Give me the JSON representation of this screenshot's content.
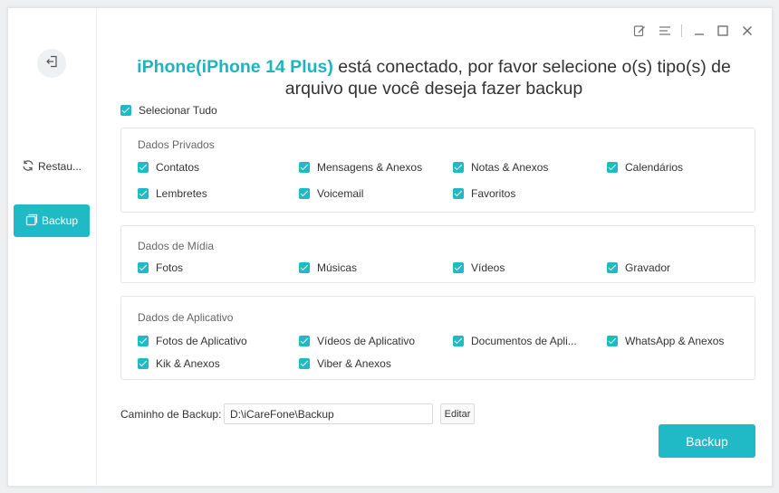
{
  "window": {
    "controls": [
      "feedback-icon",
      "menu-icon",
      "minimize-icon",
      "maximize-icon",
      "close-icon"
    ]
  },
  "sidebar": {
    "back_icon": "exit-icon",
    "items": [
      {
        "label": "Restau...",
        "icon": "restore-icon"
      },
      {
        "label": "Backup",
        "icon": "backup-icon",
        "active": true
      }
    ]
  },
  "heading": {
    "device": "iPhone(iPhone 14 Plus)",
    "line1_rest": " está conectado, por favor selecione o(s) tipo(s) de",
    "line2": "arquivo que você deseja fazer backup"
  },
  "select_all": {
    "label": "Selecionar Tudo",
    "checked": true
  },
  "groups": [
    {
      "title": "Dados Privados",
      "options": [
        {
          "label": "Contatos",
          "checked": true
        },
        {
          "label": "Mensagens & Anexos",
          "checked": true
        },
        {
          "label": "Notas & Anexos",
          "checked": true
        },
        {
          "label": "Calendários",
          "checked": true
        },
        {
          "label": "Lembretes",
          "checked": true
        },
        {
          "label": "Voicemail",
          "checked": true
        },
        {
          "label": "Favoritos",
          "checked": true
        }
      ]
    },
    {
      "title": "Dados de Mídia",
      "options": [
        {
          "label": "Fotos",
          "checked": true
        },
        {
          "label": "Músicas",
          "checked": true
        },
        {
          "label": "Vídeos",
          "checked": true
        },
        {
          "label": "Gravador",
          "checked": true
        }
      ]
    },
    {
      "title": "Dados de Aplicativo",
      "options": [
        {
          "label": "Fotos de Aplicativo",
          "checked": true
        },
        {
          "label": "Vídeos de Aplicativo",
          "checked": true
        },
        {
          "label": "Documentos de Apli...",
          "checked": true
        },
        {
          "label": "WhatsApp & Anexos",
          "checked": true
        },
        {
          "label": "Kik & Anexos",
          "checked": true
        },
        {
          "label": "Viber & Anexos",
          "checked": true
        }
      ]
    }
  ],
  "backup_path": {
    "label": "Caminho de Backup:",
    "value": "D:\\iCareFone\\Backup",
    "edit_label": "Editar"
  },
  "backup_button": {
    "label": "Backup"
  },
  "colors": {
    "accent": "#1fbac6",
    "device_text": "#1fb3c2"
  }
}
